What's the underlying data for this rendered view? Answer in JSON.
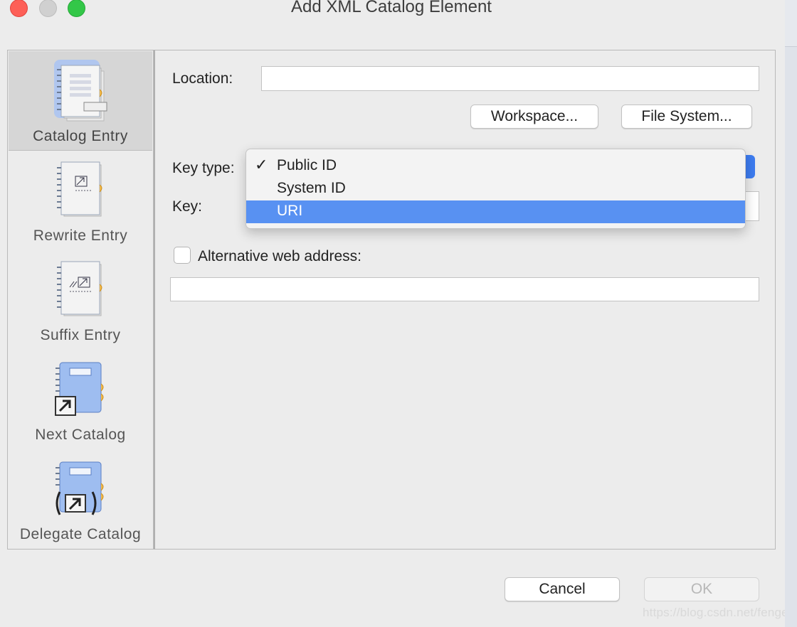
{
  "window": {
    "title": "Add XML Catalog Element"
  },
  "sidebar": {
    "items": [
      {
        "label": "Catalog Entry",
        "icon": "catalog-entry-icon",
        "selected": true
      },
      {
        "label": "Rewrite Entry",
        "icon": "rewrite-entry-icon",
        "selected": false
      },
      {
        "label": "Suffix Entry",
        "icon": "suffix-entry-icon",
        "selected": false
      },
      {
        "label": "Next Catalog",
        "icon": "next-catalog-icon",
        "selected": false
      },
      {
        "label": "Delegate Catalog",
        "icon": "delegate-catalog-icon",
        "selected": false
      }
    ]
  },
  "form": {
    "location_label": "Location:",
    "location_value": "",
    "workspace_button": "Workspace...",
    "file_system_button": "File System...",
    "key_type_label": "Key type:",
    "key_label": "Key:",
    "key_value": "",
    "alt_web_label": "Alternative web address:",
    "alt_web_checked": false,
    "alt_web_value": ""
  },
  "key_type_menu": {
    "options": [
      {
        "label": "Public ID",
        "checked": true,
        "highlighted": false
      },
      {
        "label": "System ID",
        "checked": false,
        "highlighted": false
      },
      {
        "label": "URI",
        "checked": false,
        "highlighted": true
      }
    ],
    "checkmark": "✓"
  },
  "footer": {
    "cancel_button": "Cancel",
    "ok_button": "OK",
    "ok_enabled": false
  },
  "watermark": "https://blog.csdn.net/fenger_c",
  "colors": {
    "highlight": "#5891f2",
    "select_arrow": "#3d7cf0",
    "close": "#fd5f57",
    "maximize": "#33c748"
  }
}
